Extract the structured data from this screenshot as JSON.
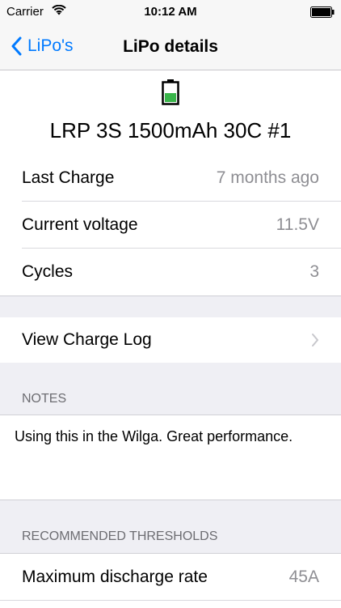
{
  "status_bar": {
    "carrier": "Carrier",
    "time": "10:12 AM"
  },
  "nav": {
    "back_label": "LiPo's",
    "title": "LiPo details"
  },
  "battery": {
    "name": "LRP 3S 1500mAh 30C #1",
    "fill_color": "#39b54a"
  },
  "details": [
    {
      "label": "Last Charge",
      "value": "7 months ago"
    },
    {
      "label": "Current voltage",
      "value": "11.5V"
    },
    {
      "label": "Cycles",
      "value": "3"
    }
  ],
  "charge_log": {
    "label": "View Charge Log"
  },
  "notes": {
    "header": "NOTES",
    "text": "Using this in the Wilga. Great performance."
  },
  "thresholds": {
    "header": "RECOMMENDED THRESHOLDS",
    "items": [
      {
        "label": "Maximum discharge rate",
        "value": "45A"
      }
    ]
  },
  "colors": {
    "accent": "#007aff",
    "secondary_text": "#8e8e93",
    "group_background": "#efeff4"
  }
}
